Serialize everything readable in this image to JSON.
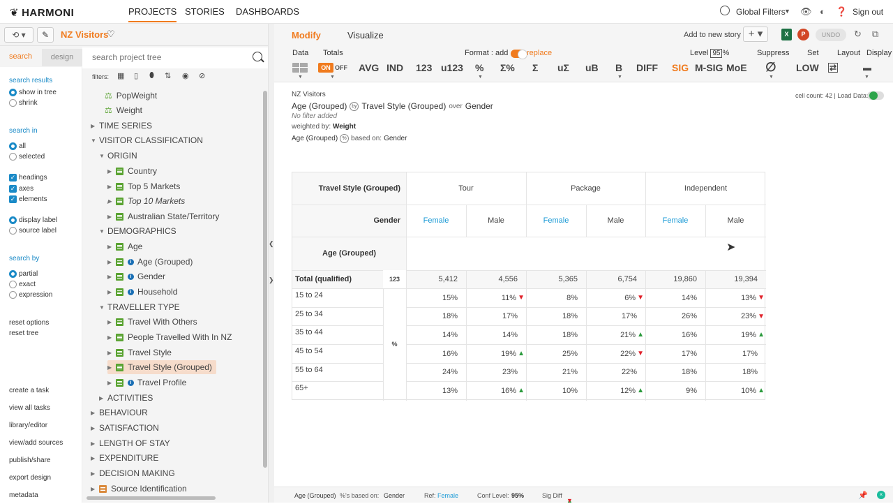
{
  "app": {
    "logo": "HARMONI"
  },
  "nav": {
    "projects": "PROJECTS",
    "stories": "STORIES",
    "dashboards": "DASHBOARDS"
  },
  "topright": {
    "global_filters": "Global Filters",
    "signout": "Sign out"
  },
  "project": {
    "name": "NZ Visitors"
  },
  "leftpanel": {
    "tab_search": "search",
    "tab_design": "design",
    "search_placeholder": "search project tree",
    "filters_label": "filters:",
    "options": {
      "search_results_h": "search results",
      "show_in_tree": "show in tree",
      "shrink": "shrink",
      "search_in_h": "search in",
      "all": "all",
      "selected": "selected",
      "headings": "headings",
      "axes": "axes",
      "elements": "elements",
      "display_label": "display label",
      "source_label": "source label",
      "search_by_h": "search by",
      "partial": "partial",
      "exact": "exact",
      "expression": "expression",
      "reset_options": "reset options",
      "reset_tree": "reset tree",
      "create_task": "create a task",
      "view_all_tasks": "view all tasks",
      "library_editor": "library/editor",
      "view_add_sources": "view/add sources",
      "publish_share": "publish/share",
      "export_design": "export design",
      "metadata": "metadata"
    },
    "tree": [
      "PopWeight",
      "Weight",
      "TIME SERIES",
      "VISITOR CLASSIFICATION",
      "ORIGIN",
      "Country",
      "Top 5 Markets",
      "Top 10 Markets",
      "Australian State/Territory",
      "DEMOGRAPHICS",
      "Age",
      "Age (Grouped)",
      "Gender",
      "Household",
      "TRAVELLER TYPE",
      "Travel With Others",
      "People Travelled With In NZ",
      "Travel Style",
      "Travel Style (Grouped)",
      "Travel Profile",
      "ACTIVITIES",
      "BEHAVIOUR",
      "SATISFACTION",
      "LENGTH OF STAY",
      "EXPENDITURE",
      "DECISION MAKING",
      "Source Identification"
    ]
  },
  "main": {
    "tab_modify": "Modify",
    "tab_visualize": "Visualize",
    "add_story": "Add to new story",
    "undo": "UNDO",
    "toolbar": {
      "data": "Data",
      "totals": "Totals",
      "format_add": "Format : add",
      "replace": "replace",
      "level": "Level",
      "level_val": "95",
      "pct": "%",
      "suppress": "Suppress",
      "set": "Set",
      "layout": "Layout",
      "display": "Display",
      "on": "ON",
      "off": "OFF",
      "avg": "AVG",
      "ind": "IND",
      "n123": "123",
      "u123": "u123",
      "pctbtn": "%",
      "sigpct": "Σ%",
      "sig": "Σ",
      "usig": "uΣ",
      "ub": "uB",
      "b": "B",
      "diff": "DIFF",
      "sigbtn": "SIG",
      "msig": "M-SIG",
      "moe": "MoE",
      "low": "LOW"
    },
    "info": {
      "title": "NZ Visitors",
      "row_var": "Age (Grouped)",
      "by": "by",
      "col_var": "Travel Style (Grouped)",
      "over": "over",
      "over_var": "Gender",
      "filter": "No filter added",
      "weighted_by_label": "weighted by:",
      "weighted_by": "Weight",
      "based_row": "Age (Grouped)",
      "based_on_label": "based on:",
      "based_on": "Gender",
      "cell_count": "cell count: 42 | Load Data:"
    },
    "table": {
      "col_header_label": "Travel Style (Grouped)",
      "col_groups": [
        "Tour",
        "Package",
        "Independent"
      ],
      "gender_label": "Gender",
      "genders": [
        "Female",
        "Male",
        "Female",
        "Male",
        "Female",
        "Male"
      ],
      "row_header_label": "Age (Grouped)",
      "total_label": "Total (qualified)",
      "total_stat": "123",
      "total_values": [
        "5,412",
        "4,556",
        "5,365",
        "6,754",
        "19,860",
        "19,394"
      ],
      "pct_stat": "%",
      "rows": [
        {
          "label": "15 to 24",
          "values": [
            "15%",
            "11%",
            "8%",
            "6%",
            "14%",
            "13%"
          ],
          "sig": [
            "",
            "dn",
            "",
            "dn",
            "",
            "dn"
          ]
        },
        {
          "label": "25 to 34",
          "values": [
            "18%",
            "17%",
            "18%",
            "17%",
            "26%",
            "23%"
          ],
          "sig": [
            "",
            "",
            "",
            "",
            "",
            "dn"
          ]
        },
        {
          "label": "35 to 44",
          "values": [
            "14%",
            "14%",
            "18%",
            "21%",
            "16%",
            "19%"
          ],
          "sig": [
            "",
            "",
            "",
            "up",
            "",
            "up"
          ]
        },
        {
          "label": "45 to 54",
          "values": [
            "16%",
            "19%",
            "25%",
            "22%",
            "17%",
            "17%"
          ],
          "sig": [
            "",
            "up",
            "",
            "dn",
            "",
            ""
          ]
        },
        {
          "label": "55 to 64",
          "values": [
            "24%",
            "23%",
            "21%",
            "22%",
            "18%",
            "18%"
          ],
          "sig": [
            "",
            "",
            "",
            "",
            "",
            ""
          ]
        },
        {
          "label": "65+",
          "values": [
            "13%",
            "16%",
            "10%",
            "12%",
            "9%",
            "10%"
          ],
          "sig": [
            "",
            "up",
            "",
            "up",
            "",
            "up"
          ]
        }
      ]
    }
  },
  "status": {
    "row_var": "Age (Grouped)",
    "based_label": "%'s based on:",
    "based": "Gender",
    "ref_label": "Ref:",
    "ref": "Female",
    "conf_label": "Conf Level:",
    "conf": "95%",
    "sigdiff_label": "Sig Diff"
  },
  "colors": {
    "accent": "#f07b1e",
    "link": "#1a9ad6",
    "up": "#2a9a3c",
    "down": "#e0212a"
  }
}
